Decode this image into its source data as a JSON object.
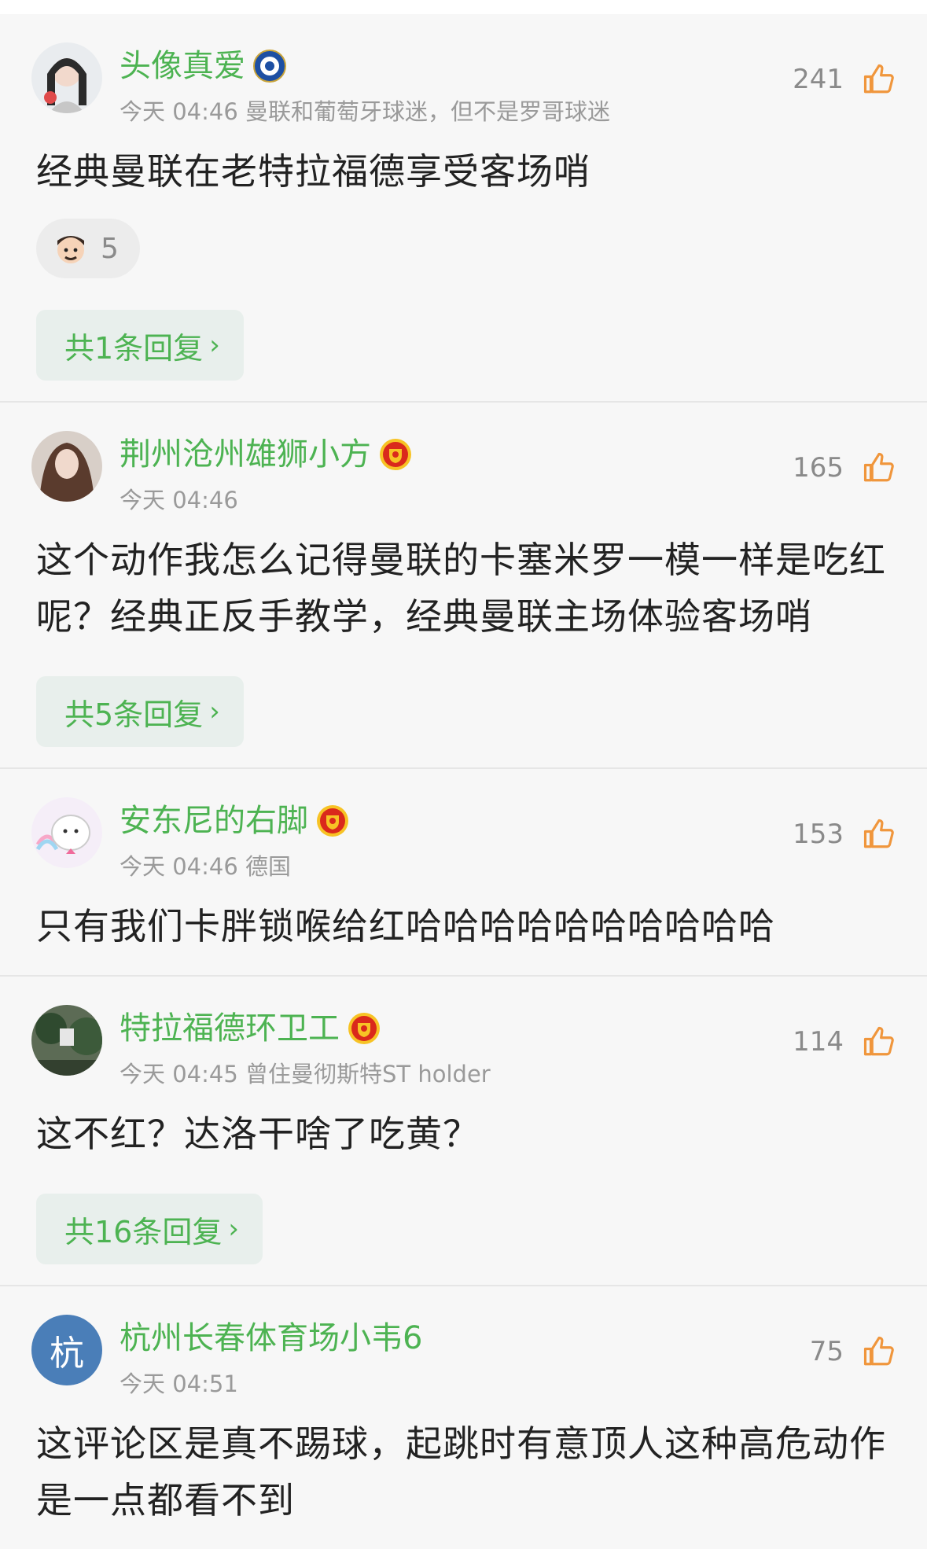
{
  "comments": [
    {
      "name": "头像真爱",
      "badge": "leicester-badge",
      "time": "今天 04:46 曼联和葡萄牙球迷，但不是罗哥球迷",
      "likes": "241",
      "text": "经典曼联在老特拉福德享受客场哨",
      "reaction_count": "5",
      "reply": "共1条回复"
    },
    {
      "name": "荆州沧州雄狮小方",
      "badge": "manutd-badge",
      "time": "今天 04:46",
      "likes": "165",
      "text": "这个动作我怎么记得曼联的卡塞米罗一模一样是吃红呢？经典正反手教学，经典曼联主场体验客场哨",
      "reply": "共5条回复"
    },
    {
      "name": "安东尼的右脚",
      "badge": "manutd-badge",
      "time": "今天 04:46 德国",
      "likes": "153",
      "text": "只有我们卡胖锁喉给红哈哈哈哈哈哈哈哈哈哈"
    },
    {
      "name": "特拉福德环卫工",
      "badge": "manutd-badge",
      "time": "今天 04:45 曾住曼彻斯特ST holder",
      "likes": "114",
      "text": "这不红？达洛干啥了吃黄？",
      "reply": "共16条回复"
    },
    {
      "name": "杭州长春体育场小韦6",
      "avatar_letter": "杭",
      "time": "今天 04:51",
      "likes": "75",
      "text": "这评论区是真不踢球，起跳时有意顶人这种高危动作是一点都看不到"
    }
  ],
  "colors": {
    "name": "#4db352",
    "like_icon": "#f0963c",
    "avatar_letter_bg": "#4a7eb8"
  },
  "icons": {
    "like": "thumbs-up-icon",
    "chevron": "chevron-right-icon"
  }
}
